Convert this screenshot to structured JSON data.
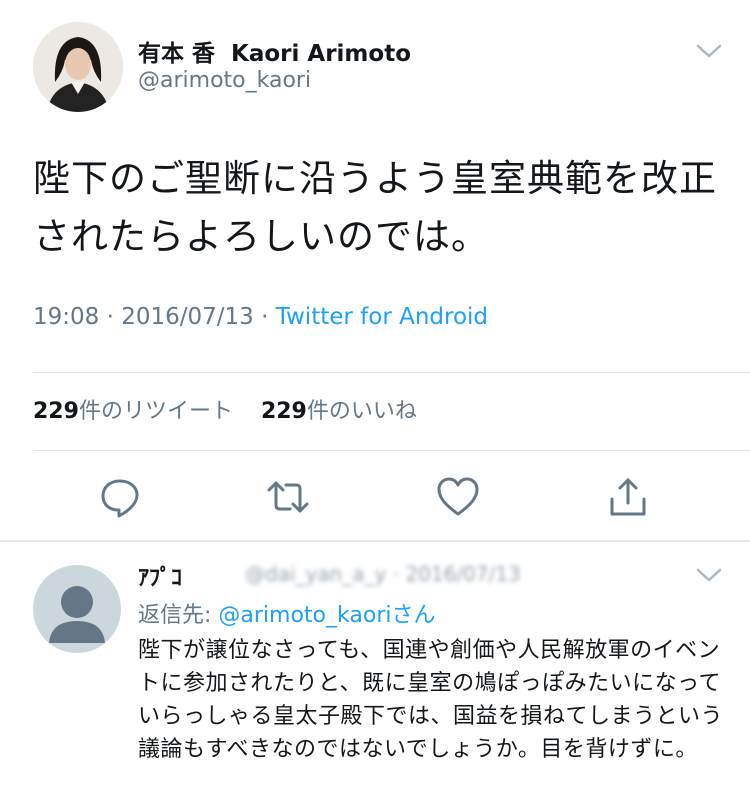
{
  "tweet": {
    "display_name": "有本 香",
    "display_name_en": "Kaori Arimoto",
    "handle": "@arimoto_kaori",
    "text": "陛下のご聖断に沿うよう皇室典範を改正されたらよろしいのでは。",
    "time": "19:08",
    "dot": "·",
    "date": "2016/07/13",
    "source": "Twitter for Android",
    "retweet_count": "229",
    "retweet_label": "件のリツイート",
    "like_count": "229",
    "like_label": "件のいいね"
  },
  "reply": {
    "name": "ｱﾌﾟｺ",
    "handle_date": "@dai_yan_a_y · 2016/07/13",
    "reply_to_label": "返信先: ",
    "reply_to_handle": "@arimoto_kaori",
    "reply_to_suffix": "さん",
    "text": "陛下が譲位なさっても、国連や創価や人民解放軍のイベントに参加されたりと、既に皇室の鳩ぽっぽみたいになっていらっしゃる皇太子殿下では、国益を損ねてしまうという議論もすべきなのではないでしょうか。目を背けずに。"
  },
  "colors": {
    "accent": "#1da1f2",
    "secondary_text": "#657786",
    "primary_text": "#14171a",
    "divider": "#e1e8ed"
  },
  "icons": [
    "chevron-down-icon",
    "reply-icon",
    "retweet-icon",
    "like-icon",
    "share-icon",
    "default-avatar-icon"
  ]
}
